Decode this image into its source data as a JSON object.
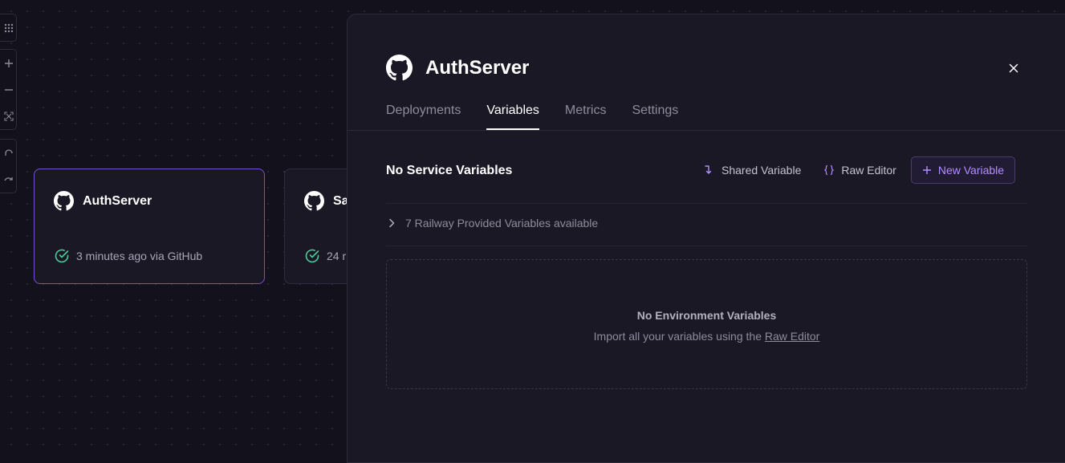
{
  "colors": {
    "background": "#13111c",
    "panel": "#1a1824",
    "accent": "#7c4ed6",
    "accent_text": "#b48dff",
    "success": "#4fc99a"
  },
  "toolbar": {
    "icons": [
      "grid-icon",
      "zoom-in-icon",
      "zoom-out-icon",
      "fit-view-icon",
      "undo-icon",
      "redo-icon"
    ]
  },
  "canvas": {
    "cards": [
      {
        "title": "AuthServer",
        "status": "3 minutes ago via GitHub",
        "icon": "github-icon",
        "selected": true
      },
      {
        "title": "Sa",
        "status": "24 r",
        "icon": "github-icon",
        "selected": false
      }
    ]
  },
  "panel": {
    "title": "AuthServer",
    "tabs": [
      {
        "label": "Deployments",
        "active": false
      },
      {
        "label": "Variables",
        "active": true
      },
      {
        "label": "Metrics",
        "active": false
      },
      {
        "label": "Settings",
        "active": false
      }
    ],
    "section_title": "No Service Variables",
    "actions": {
      "shared_variable": "Shared Variable",
      "raw_editor": "Raw Editor",
      "new_variable": "New Variable"
    },
    "provided_variables": "7 Railway Provided Variables available",
    "empty_state": {
      "title": "No Environment Variables",
      "subtitle_prefix": "Import all your variables using the",
      "subtitle_link": "Raw Editor"
    }
  }
}
